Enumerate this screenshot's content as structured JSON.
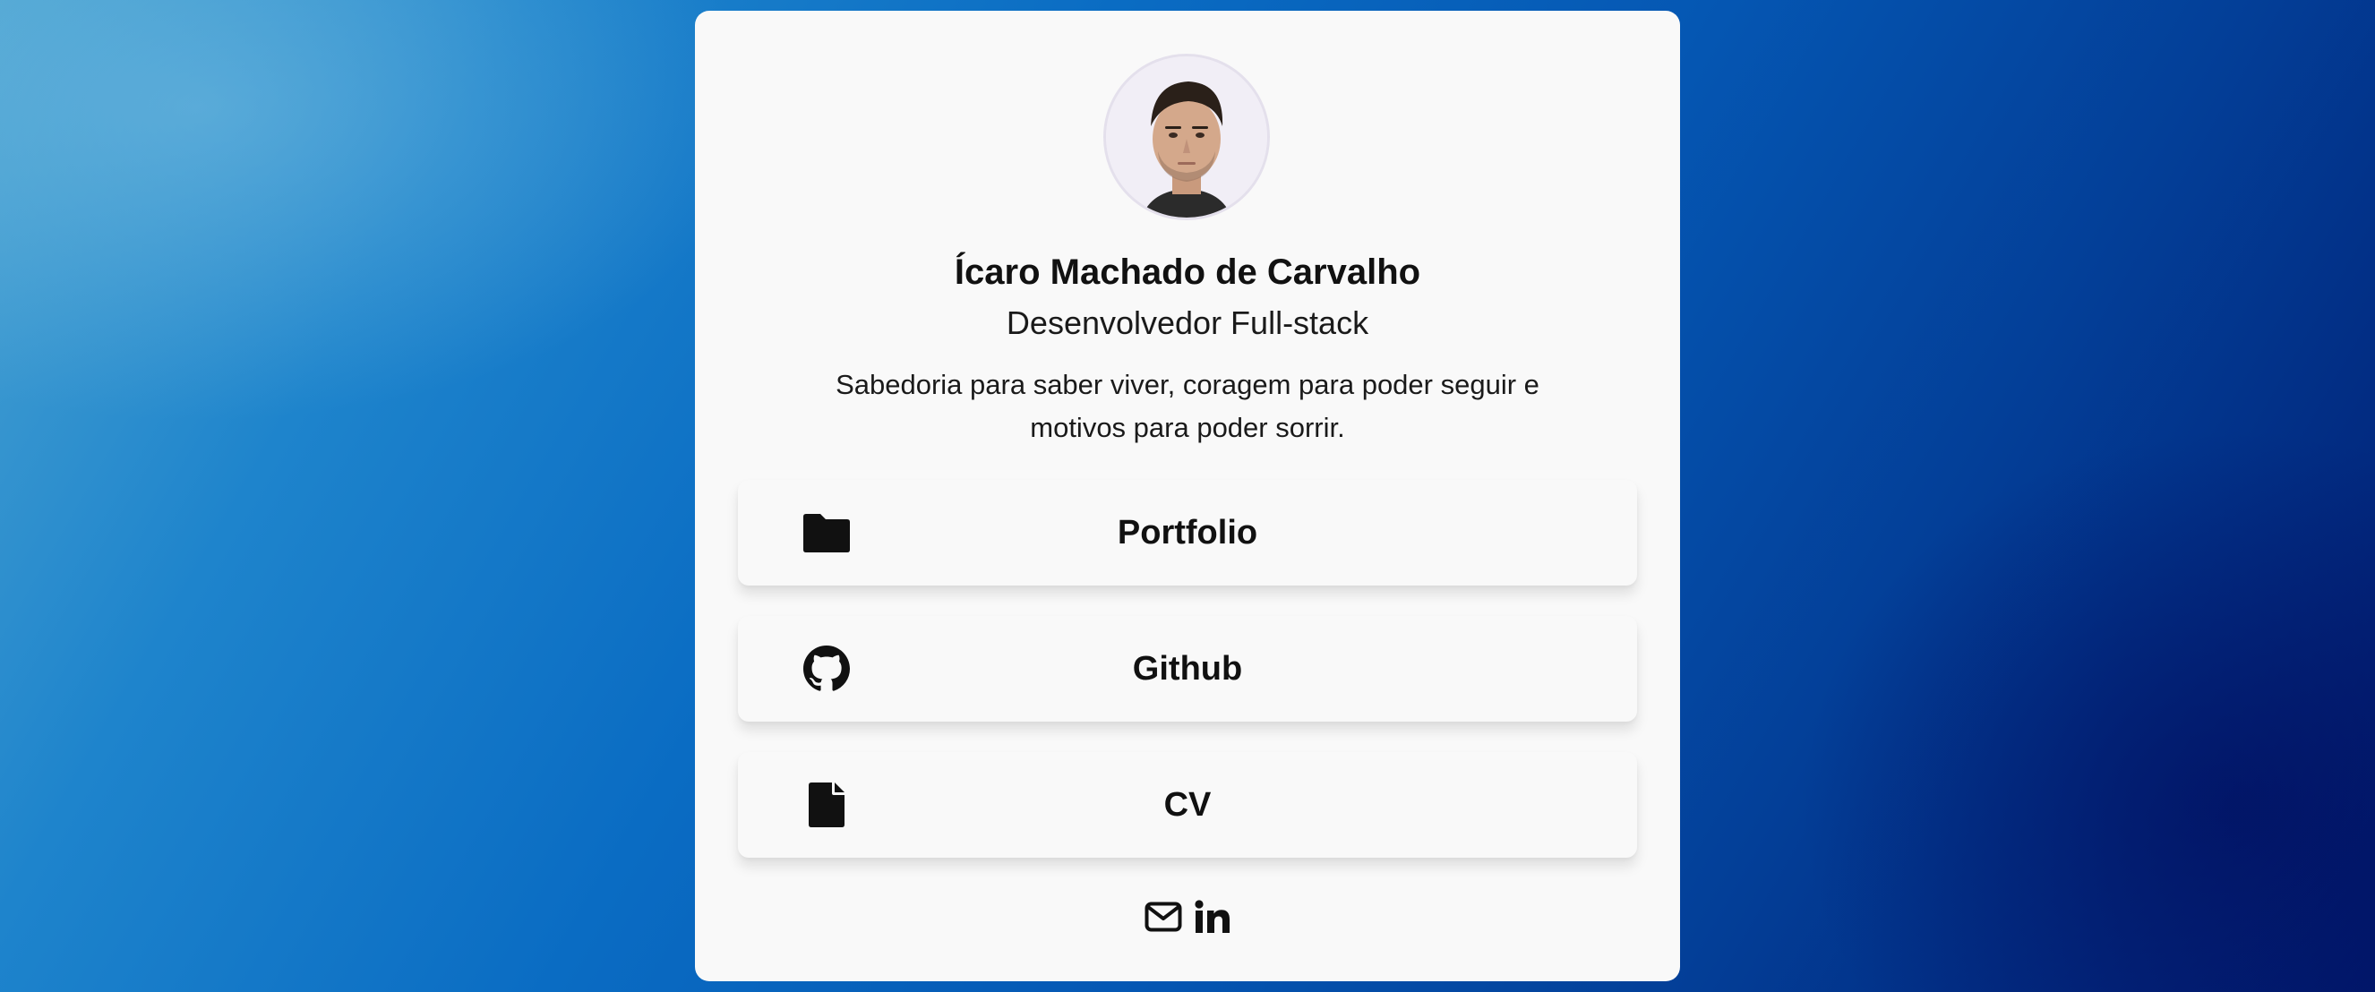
{
  "profile": {
    "name": "Ícaro Machado de Carvalho",
    "role": "Desenvolvedor Full-stack",
    "bio": "Sabedoria para saber viver, coragem para poder seguir e motivos para poder sorrir."
  },
  "links": [
    {
      "label": "Portfolio",
      "icon": "folder-icon"
    },
    {
      "label": "Github",
      "icon": "github-icon"
    },
    {
      "label": "CV",
      "icon": "file-icon"
    }
  ],
  "socials": [
    {
      "icon": "envelope-icon"
    },
    {
      "icon": "linkedin-icon"
    }
  ],
  "colors": {
    "card": "#f9f9f9",
    "text": "#111111",
    "background_start": "#4aa3d2",
    "background_end": "#011a6e"
  }
}
